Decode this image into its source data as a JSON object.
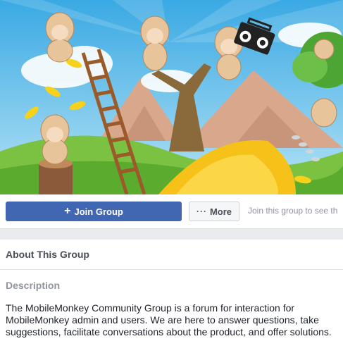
{
  "cover": {
    "alt_icons": [
      "monkey-icon",
      "boombox-icon",
      "ladder-icon",
      "banana-icon"
    ]
  },
  "actions": {
    "join_label": "Join Group",
    "join_icon": "+",
    "more_label": "More",
    "more_icon": "···",
    "hint_text": "Join this group to see th"
  },
  "about": {
    "title": "About This Group",
    "description_label": "Description",
    "description_text": "The MobileMonkey Community Group is a forum for interaction for MobileMonkey admin and users. We are here to answer questions, take suggestions, facilitate conversations about the product, and offer solutions."
  },
  "colors": {
    "primary": "#4267b2",
    "page_bg": "#e9ebee",
    "muted": "#90949c"
  }
}
